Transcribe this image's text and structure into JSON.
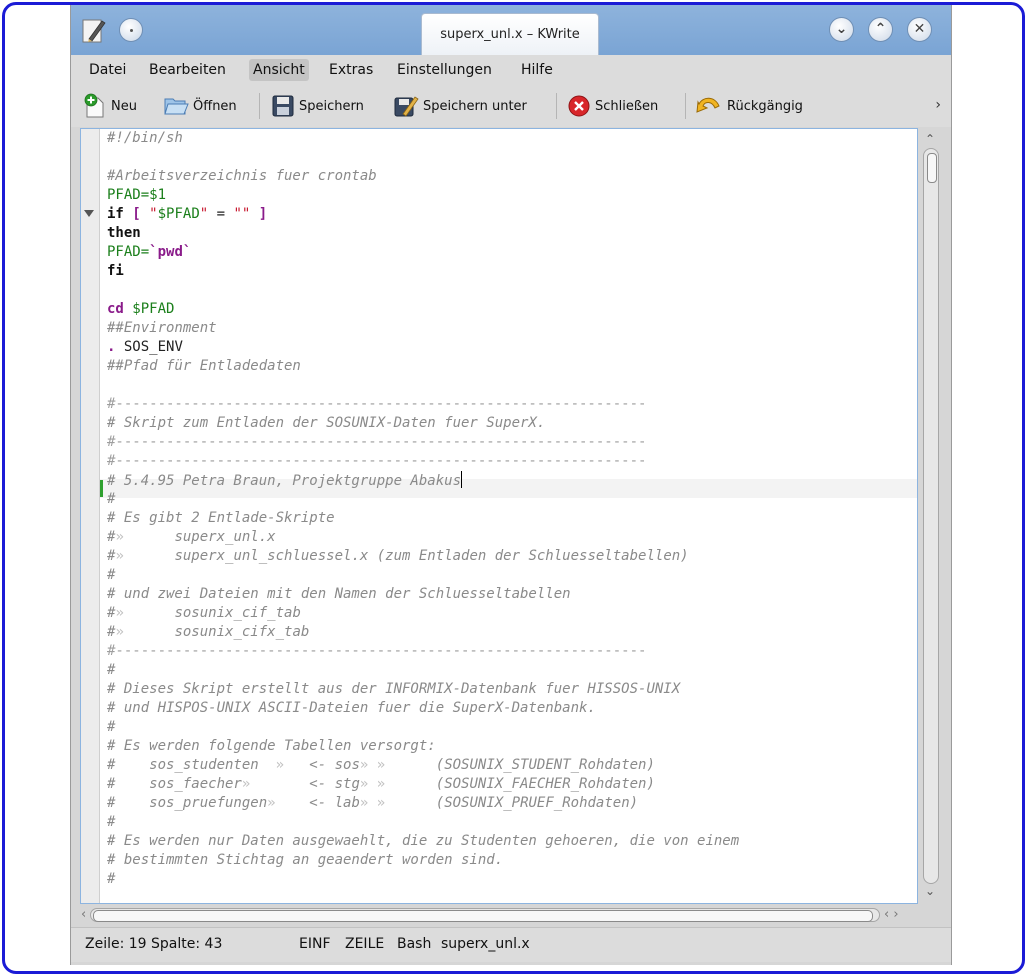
{
  "window": {
    "title": "superx_unl.x – KWrite",
    "controls": {
      "minimize_icon": "chevron-down-icon",
      "maximize_icon": "chevron-up-icon",
      "close_icon": "close-icon"
    }
  },
  "menubar": {
    "items": [
      "Datei",
      "Bearbeiten",
      "Ansicht",
      "Extras",
      "Einstellungen",
      "Hilfe"
    ],
    "active": "Ansicht"
  },
  "toolbar": {
    "new_label": "Neu",
    "open_label": "Öffnen",
    "save_label": "Speichern",
    "save_as_label": "Speichern unter",
    "close_label": "Schließen",
    "undo_label": "Rückgängig",
    "more_label": "›"
  },
  "editor": {
    "lines": [
      "#!/bin/sh",
      "",
      "#Arbeitsverzeichnis fuer crontab",
      "PFAD=$1",
      "if [ \"$PFAD\" = \"\" ]",
      "then",
      "PFAD=`pwd`",
      "fi",
      "",
      "cd $PFAD",
      "##Environment",
      ". SOS_ENV",
      "##Pfad für Entladedaten",
      "",
      "#---------------------------------------------------------------",
      "# Skript zum Entladen der SOSUNIX-Daten fuer SuperX.",
      "#---------------------------------------------------------------",
      "#---------------------------------------------------------------",
      "# 5.4.95 Petra Braun, Projektgruppe Abakus",
      "#",
      "# Es gibt 2 Entlade-Skripte",
      "#»      superx_unl.x",
      "#»      superx_unl_schluessel.x (zum Entladen der Schluesseltabellen)",
      "#",
      "# und zwei Dateien mit den Namen der Schluesseltabellen",
      "#»      sosunix_cif_tab",
      "#»      sosunix_cifx_tab",
      "#---------------------------------------------------------------",
      "#",
      "# Dieses Skript erstellt aus der INFORMIX-Datenbank fuer HISSOS-UNIX",
      "# und HISPOS-UNIX ASCII-Dateien fuer die SuperX-Datenbank.",
      "#",
      "# Es werden folgende Tabellen versorgt:",
      "#    sos_studenten  »   <- sos» »      (SOSUNIX_STUDENT_Rohdaten)",
      "#    sos_faecher»       <- stg» »      (SOSUNIX_FAECHER_Rohdaten)",
      "#    sos_pruefungen»    <- lab» »      (SOSUNIX_PRUEF_Rohdaten)",
      "#",
      "# Es werden nur Daten ausgewaehlt, die zu Studenten gehoeren, die von einem",
      "# bestimmten Stichtag an geaendert worden sind.",
      "#"
    ]
  },
  "statusbar": {
    "position": "Zeile: 19 Spalte: 43",
    "mode": "EINF",
    "select_mode": "ZEILE",
    "syntax": "Bash",
    "filename": "superx_unl.x"
  }
}
